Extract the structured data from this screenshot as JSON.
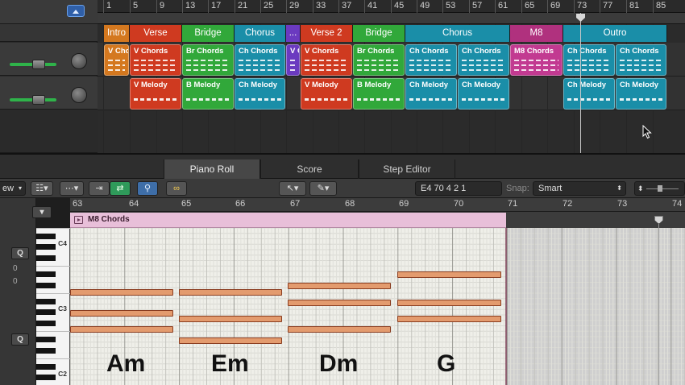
{
  "arrange": {
    "ruler_bars": [
      "1",
      "5",
      "9",
      "13",
      "17",
      "21",
      "25",
      "29",
      "33",
      "37",
      "41",
      "45",
      "49",
      "53",
      "57",
      "61",
      "65",
      "69",
      "73",
      "77",
      "81",
      "85"
    ],
    "markers": [
      {
        "label": "Intro",
        "color": "#d4781f",
        "start": 129,
        "end": 161
      },
      {
        "label": "Verse",
        "color": "#cf3a20",
        "start": 161,
        "end": 226
      },
      {
        "label": "Bridge",
        "color": "#31a83a",
        "start": 226,
        "end": 291
      },
      {
        "label": "Chorus",
        "color": "#1a8ea8",
        "start": 291,
        "end": 355
      },
      {
        "label": "...",
        "color": "#6b3ac0",
        "start": 355,
        "end": 373
      },
      {
        "label": "Verse 2",
        "color": "#cf3a20",
        "start": 373,
        "end": 438
      },
      {
        "label": "Bridge",
        "color": "#31a83a",
        "start": 438,
        "end": 503
      },
      {
        "label": "Chorus",
        "color": "#1a8ea8",
        "start": 503,
        "end": 633
      },
      {
        "label": "M8",
        "color": "#b0317e",
        "start": 633,
        "end": 699
      },
      {
        "label": "Outro",
        "color": "#1a8ea8",
        "start": 699,
        "end": 828
      }
    ],
    "chord_regions": [
      {
        "label": "V Cho",
        "color": "#d4781f",
        "start": 129,
        "end": 161
      },
      {
        "label": "V Chords",
        "color": "#cf3a20",
        "start": 161,
        "end": 226
      },
      {
        "label": "Br Chords",
        "color": "#31a83a",
        "start": 226,
        "end": 291
      },
      {
        "label": "Ch Chords",
        "color": "#1a8ea8",
        "start": 291,
        "end": 355
      },
      {
        "label": "V C",
        "color": "#6b3ac0",
        "start": 355,
        "end": 373
      },
      {
        "label": "V Chords",
        "color": "#cf3a20",
        "start": 373,
        "end": 438
      },
      {
        "label": "Br Chords",
        "color": "#31a83a",
        "start": 438,
        "end": 503
      },
      {
        "label": "Ch Chords",
        "color": "#1a8ea8",
        "start": 503,
        "end": 568
      },
      {
        "label": "Ch Chords",
        "color": "#1a8ea8",
        "start": 568,
        "end": 633
      },
      {
        "label": "M8 Chords",
        "color": "#c23a91",
        "start": 633,
        "end": 699
      },
      {
        "label": "Ch Chords",
        "color": "#1a8ea8",
        "start": 699,
        "end": 764
      },
      {
        "label": "Ch Chords",
        "color": "#1a8ea8",
        "start": 764,
        "end": 828
      }
    ],
    "melody_regions": [
      {
        "label": "V Melody",
        "color": "#cf3a20",
        "start": 161,
        "end": 226
      },
      {
        "label": "B Melody",
        "color": "#31a83a",
        "start": 226,
        "end": 291
      },
      {
        "label": "Ch Melody",
        "color": "#1a8ea8",
        "start": 291,
        "end": 355
      },
      {
        "label": "V Melody",
        "color": "#cf3a20",
        "start": 373,
        "end": 438
      },
      {
        "label": "B Melody",
        "color": "#31a83a",
        "start": 438,
        "end": 503
      },
      {
        "label": "Ch Melody",
        "color": "#1a8ea8",
        "start": 503,
        "end": 568
      },
      {
        "label": "Ch Melody",
        "color": "#1a8ea8",
        "start": 568,
        "end": 633
      },
      {
        "label": "Ch Melody",
        "color": "#1a8ea8",
        "start": 699,
        "end": 764
      },
      {
        "label": "Ch Melody",
        "color": "#1a8ea8",
        "start": 764,
        "end": 828
      }
    ]
  },
  "editor_tabs": [
    {
      "label": "Piano Roll",
      "active": true
    },
    {
      "label": "Score",
      "active": false
    },
    {
      "label": "Step Editor",
      "active": false
    }
  ],
  "toolbar": {
    "view_label": "ew",
    "position_display": "E4   70 4 2 1",
    "snap_label": "Snap:",
    "snap_value": "Smart"
  },
  "piano_roll": {
    "bar_numbers": [
      "63",
      "64",
      "65",
      "66",
      "67",
      "68",
      "69",
      "70",
      "71",
      "72",
      "73",
      "74"
    ],
    "region_name": "M8 Chords",
    "octave_labels": [
      "C4",
      "C3",
      "C2"
    ],
    "left_panel": {
      "q_label": "Q",
      "value1": "0",
      "value2": "0"
    },
    "chords": [
      {
        "name": "Am"
      },
      {
        "name": "Em"
      },
      {
        "name": "Dm"
      },
      {
        "name": "G"
      }
    ]
  },
  "colors": {
    "accent_blue": "#2f5fa8",
    "note_fill": "#e39b6e",
    "region_pink": "#e8bfd9"
  }
}
